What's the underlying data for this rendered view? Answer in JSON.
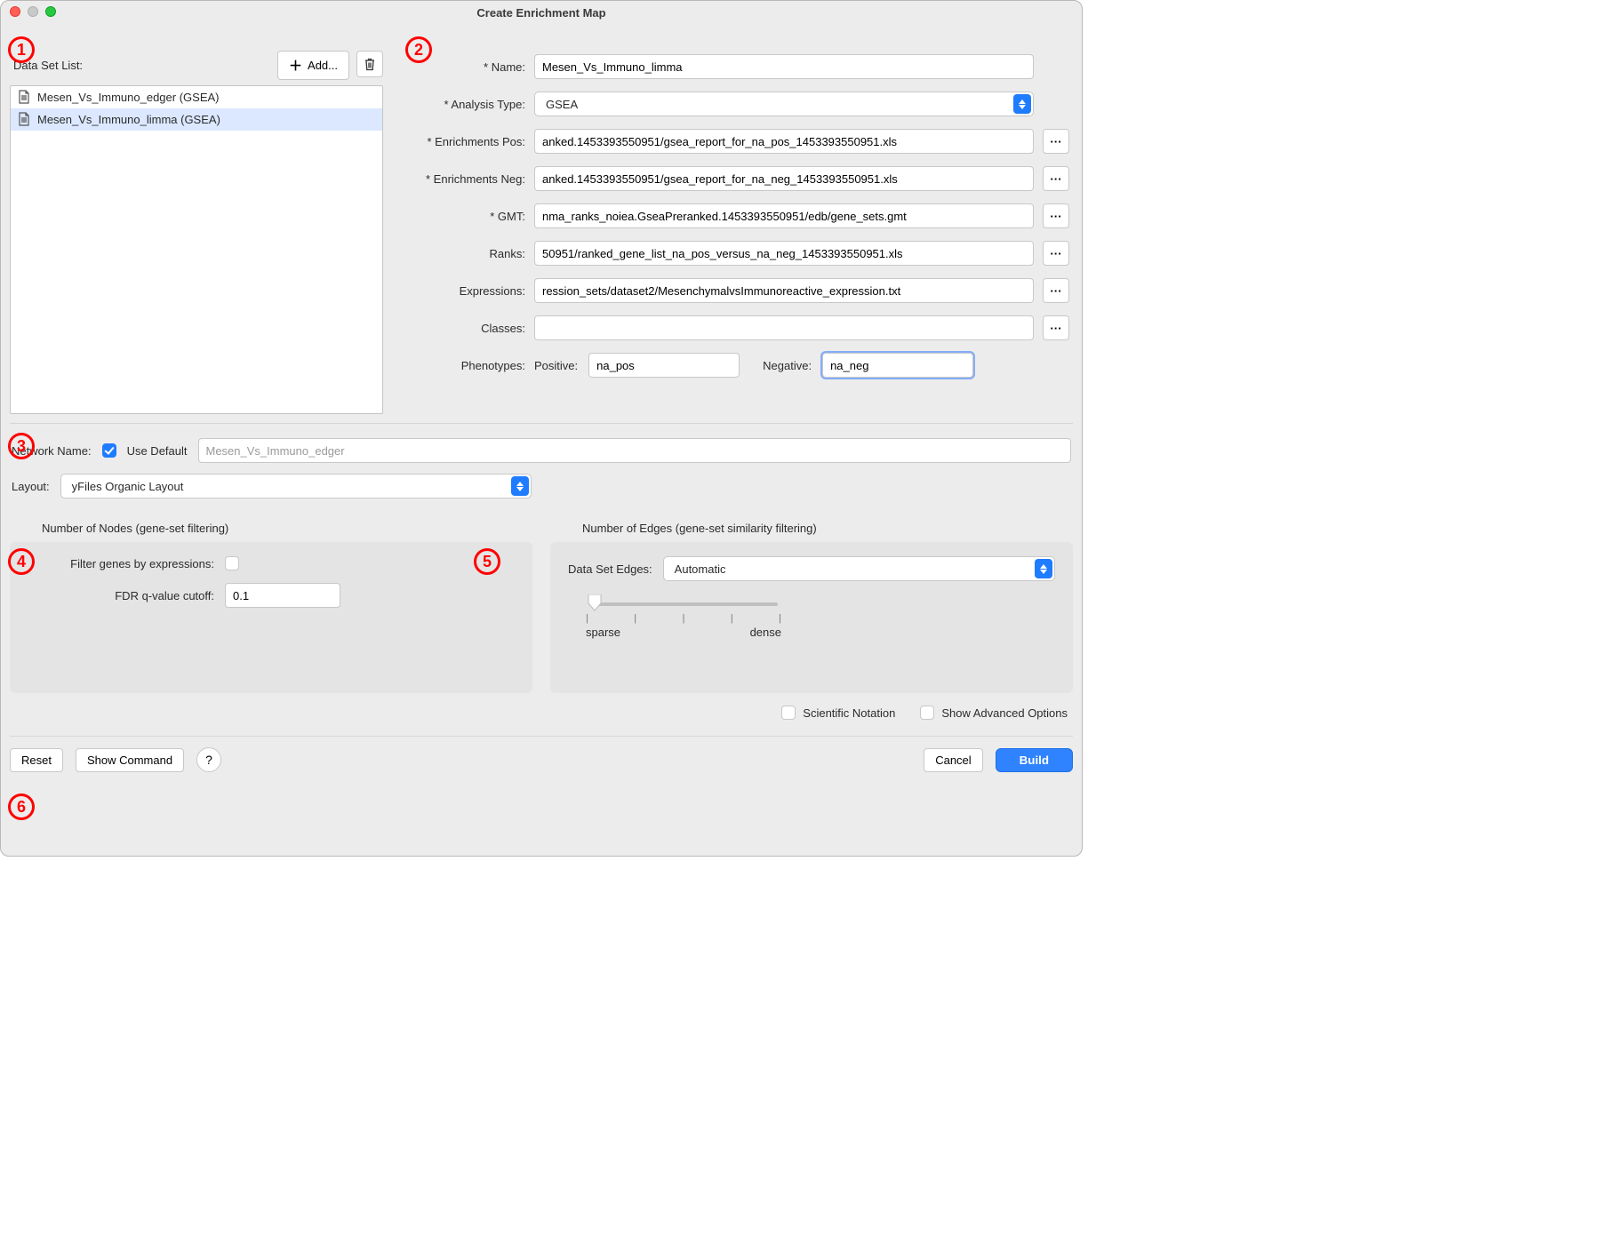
{
  "window": {
    "title": "Create Enrichment Map"
  },
  "callouts": {
    "c1": "1",
    "c2": "2",
    "c3": "3",
    "c4": "4",
    "c5": "5",
    "c6": "6"
  },
  "sidebar": {
    "label": "Data Set List:",
    "add_label": "Add...",
    "items": [
      {
        "text": "Mesen_Vs_Immuno_edger  (GSEA)",
        "selected": false
      },
      {
        "text": "Mesen_Vs_Immuno_limma  (GSEA)",
        "selected": true
      }
    ]
  },
  "form": {
    "name_label": "* Name:",
    "name_value": "Mesen_Vs_Immuno_limma",
    "analysis_label": "* Analysis Type:",
    "analysis_value": "GSEA",
    "enrich_pos_label": "* Enrichments Pos:",
    "enrich_pos_value": "anked.1453393550951/gsea_report_for_na_pos_1453393550951.xls",
    "enrich_neg_label": "* Enrichments Neg:",
    "enrich_neg_value": "anked.1453393550951/gsea_report_for_na_neg_1453393550951.xls",
    "gmt_label": "* GMT:",
    "gmt_value": "nma_ranks_noiea.GseaPreranked.1453393550951/edb/gene_sets.gmt",
    "ranks_label": "Ranks:",
    "ranks_value": "50951/ranked_gene_list_na_pos_versus_na_neg_1453393550951.xls",
    "expr_label": "Expressions:",
    "expr_value": "ression_sets/dataset2/MesenchymalvsImmunoreactive_expression.txt",
    "classes_label": "Classes:",
    "classes_value": "",
    "pheno_label": "Phenotypes:",
    "pheno_pos_label": "Positive:",
    "pheno_pos_value": "na_pos",
    "pheno_neg_label": "Negative:",
    "pheno_neg_value": "na_neg",
    "browse_label": "···"
  },
  "network": {
    "name_label": "Network Name:",
    "use_default_label": "Use Default",
    "use_default_checked": true,
    "name_value": "Mesen_Vs_Immuno_edger",
    "layout_label": "Layout:",
    "layout_value": "yFiles Organic Layout"
  },
  "nodes": {
    "title": "Number of Nodes (gene-set filtering)",
    "filter_label": "Filter genes by expressions:",
    "filter_checked": false,
    "fdr_label": "FDR q-value cutoff:",
    "fdr_value": "0.1"
  },
  "edges": {
    "title": "Number of Edges (gene-set similarity filtering)",
    "ds_edges_label": "Data Set Edges:",
    "ds_edges_value": "Automatic",
    "slider_left": "sparse",
    "slider_right": "dense",
    "slider_pos_pct": 3
  },
  "options": {
    "scinot_label": "Scientific Notation",
    "scinot_checked": false,
    "advanced_label": "Show Advanced Options",
    "advanced_checked": false
  },
  "footer": {
    "reset": "Reset",
    "show_cmd": "Show Command",
    "help": "?",
    "cancel": "Cancel",
    "build": "Build"
  }
}
